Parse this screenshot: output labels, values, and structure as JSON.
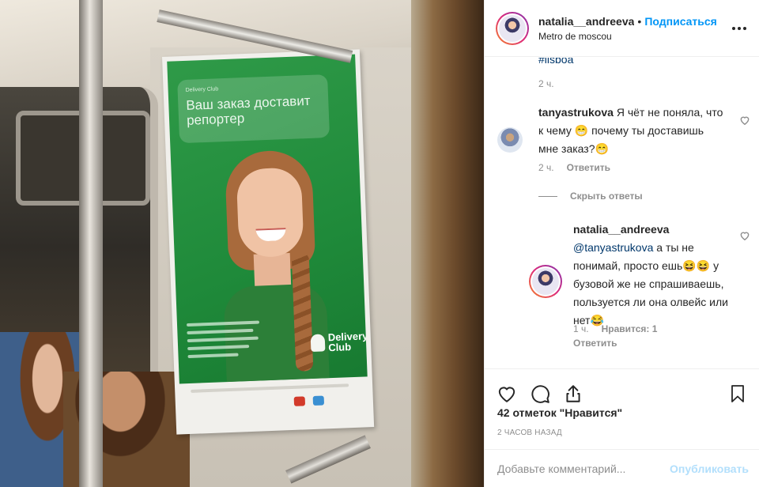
{
  "post": {
    "username": "natalia__andreeva",
    "follow_label": "Подписаться",
    "dot": "•",
    "location": "Metro de moscou"
  },
  "poster": {
    "small_line": "Delivery Club",
    "headline": "Ваш заказ доставит репортер",
    "brand": "Delivery Club"
  },
  "caption": {
    "hashtag": "#lisboa",
    "time": "2 ч."
  },
  "comments": [
    {
      "username": "tanyastrukova",
      "text": " Я чёт не поняла, что к чему 😁 почему ты доставишь мне заказ?😁",
      "time": "2 ч.",
      "reply_label": "Ответить"
    }
  ],
  "hide_replies_label": "Скрыть ответы",
  "reply": {
    "username": "natalia__andreeva",
    "mention": "@tanyastrukova",
    "text": " а ты не понимай, просто ешь😆😆 у бузовой же не спрашиваешь, пользуется ли она олвейс или нет😂",
    "time": "1 ч.",
    "likes_label": "Нравится: 1",
    "reply_label": "Ответить"
  },
  "footer": {
    "likes": "42 отметок \"Нравится\"",
    "time_ago": "2 часов назад",
    "comment_placeholder": "Добавьте комментарий...",
    "publish_label": "Опубликовать"
  },
  "colors": {
    "link_blue": "#0095f6",
    "mention_blue": "#00376b",
    "muted": "#8e8e8e",
    "publish_disabled": "#b2dffc"
  },
  "icons": [
    "more-options-icon",
    "heart-icon",
    "comment-icon",
    "share-icon",
    "bookmark-icon"
  ]
}
